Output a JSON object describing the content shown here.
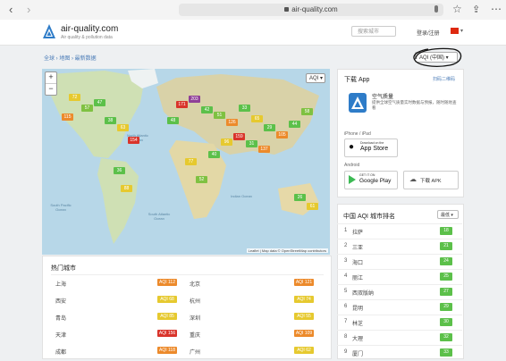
{
  "browser": {
    "url": "air-quality.com",
    "back": "‹",
    "forward": "›",
    "font_size_label": "AA"
  },
  "site": {
    "name": "air-quality.com",
    "tagline": "Air quality & pollution data",
    "search_placeholder": "搜索城市",
    "login": "登录/注册",
    "lang_caret": "▾"
  },
  "breadcrumb": "全球 › 地图 › 最新数据",
  "scale_select": "AQI (中国) ▾",
  "map": {
    "zoom_in": "+",
    "zoom_out": "−",
    "layer": "AQI ▾",
    "attribution": "Leaflet | Map data © OpenStreetMap contributors",
    "ocean_labels": [
      "North Pacific Ocean",
      "North Atlantic Ocean",
      "South Atlantic Ocean",
      "Indian Ocean",
      "South Pacific Ocean"
    ],
    "markers": [
      {
        "v": "72",
        "c": "#e6c92f"
      },
      {
        "v": "57",
        "c": "#7fc142"
      },
      {
        "v": "47",
        "c": "#5cc04a"
      },
      {
        "v": "115",
        "c": "#ec8a2b"
      },
      {
        "v": "38",
        "c": "#5cc04a"
      },
      {
        "v": "63",
        "c": "#e6c92f"
      },
      {
        "v": "154",
        "c": "#d9342b"
      },
      {
        "v": "36",
        "c": "#5cc04a"
      },
      {
        "v": "88",
        "c": "#e6c92f"
      },
      {
        "v": "171",
        "c": "#d9342b"
      },
      {
        "v": "203",
        "c": "#8f3f97"
      },
      {
        "v": "42",
        "c": "#5cc04a"
      },
      {
        "v": "51",
        "c": "#7fc142"
      },
      {
        "v": "126",
        "c": "#ec8a2b"
      },
      {
        "v": "33",
        "c": "#5cc04a"
      },
      {
        "v": "65",
        "c": "#e6c92f"
      },
      {
        "v": "29",
        "c": "#5cc04a"
      },
      {
        "v": "105",
        "c": "#ec8a2b"
      },
      {
        "v": "44",
        "c": "#5cc04a"
      },
      {
        "v": "58",
        "c": "#7fc142"
      },
      {
        "v": "159",
        "c": "#d9342b"
      },
      {
        "v": "31",
        "c": "#5cc04a"
      },
      {
        "v": "77",
        "c": "#e6c92f"
      },
      {
        "v": "52",
        "c": "#7fc142"
      },
      {
        "v": "40",
        "c": "#5cc04a"
      },
      {
        "v": "96",
        "c": "#e6c92f"
      },
      {
        "v": "137",
        "c": "#ec8a2b"
      },
      {
        "v": "26",
        "c": "#5cc04a"
      },
      {
        "v": "61",
        "c": "#e6c92f"
      },
      {
        "v": "48",
        "c": "#5cc04a"
      }
    ]
  },
  "app_panel": {
    "title": "下载 App",
    "scan_link": "扫码二维码",
    "app_name": "空气质量",
    "app_desc": "提供全球空气质量实时数据与预报，随时随地查看",
    "iphone_label": "iPhone / iPad",
    "appstore_small": "Download on the",
    "appstore_big": "App Store",
    "android_label": "Android",
    "googleplay_small": "GET IT ON",
    "googleplay_big": "Google Play",
    "apk_label": "下载 APK"
  },
  "ranking": {
    "title": "中国 AQI 城市排名",
    "filter": "最低 ▾",
    "rows": [
      {
        "n": "1",
        "city": "拉萨",
        "aqi": "18"
      },
      {
        "n": "2",
        "city": "三亚",
        "aqi": "21"
      },
      {
        "n": "3",
        "city": "海口",
        "aqi": "24"
      },
      {
        "n": "4",
        "city": "丽江",
        "aqi": "25"
      },
      {
        "n": "5",
        "city": "西双版纳",
        "aqi": "27"
      },
      {
        "n": "6",
        "city": "昆明",
        "aqi": "29"
      },
      {
        "n": "7",
        "city": "林芝",
        "aqi": "30"
      },
      {
        "n": "8",
        "city": "大理",
        "aqi": "32"
      },
      {
        "n": "9",
        "city": "厦门",
        "aqi": "33"
      }
    ]
  },
  "popular": {
    "title": "热门城市",
    "left": [
      {
        "city": "上海",
        "aqi": "AQI 112",
        "c": "#ec8a2b"
      },
      {
        "city": "西安",
        "aqi": "AQI 68",
        "c": "#e6c92f"
      },
      {
        "city": "青岛",
        "aqi": "AQI 85",
        "c": "#e6c92f"
      },
      {
        "city": "天津",
        "aqi": "AQI 156",
        "c": "#d9342b"
      },
      {
        "city": "成都",
        "aqi": "AQI 118",
        "c": "#ec8a2b"
      }
    ],
    "right": [
      {
        "city": "北京",
        "aqi": "AQI 121",
        "c": "#ec8a2b"
      },
      {
        "city": "杭州",
        "aqi": "AQI 74",
        "c": "#e6c92f"
      },
      {
        "city": "深圳",
        "aqi": "AQI 55",
        "c": "#e6c92f"
      },
      {
        "city": "重庆",
        "aqi": "AQI 109",
        "c": "#ec8a2b"
      },
      {
        "city": "广州",
        "aqi": "AQI 62",
        "c": "#e6c92f"
      }
    ]
  }
}
